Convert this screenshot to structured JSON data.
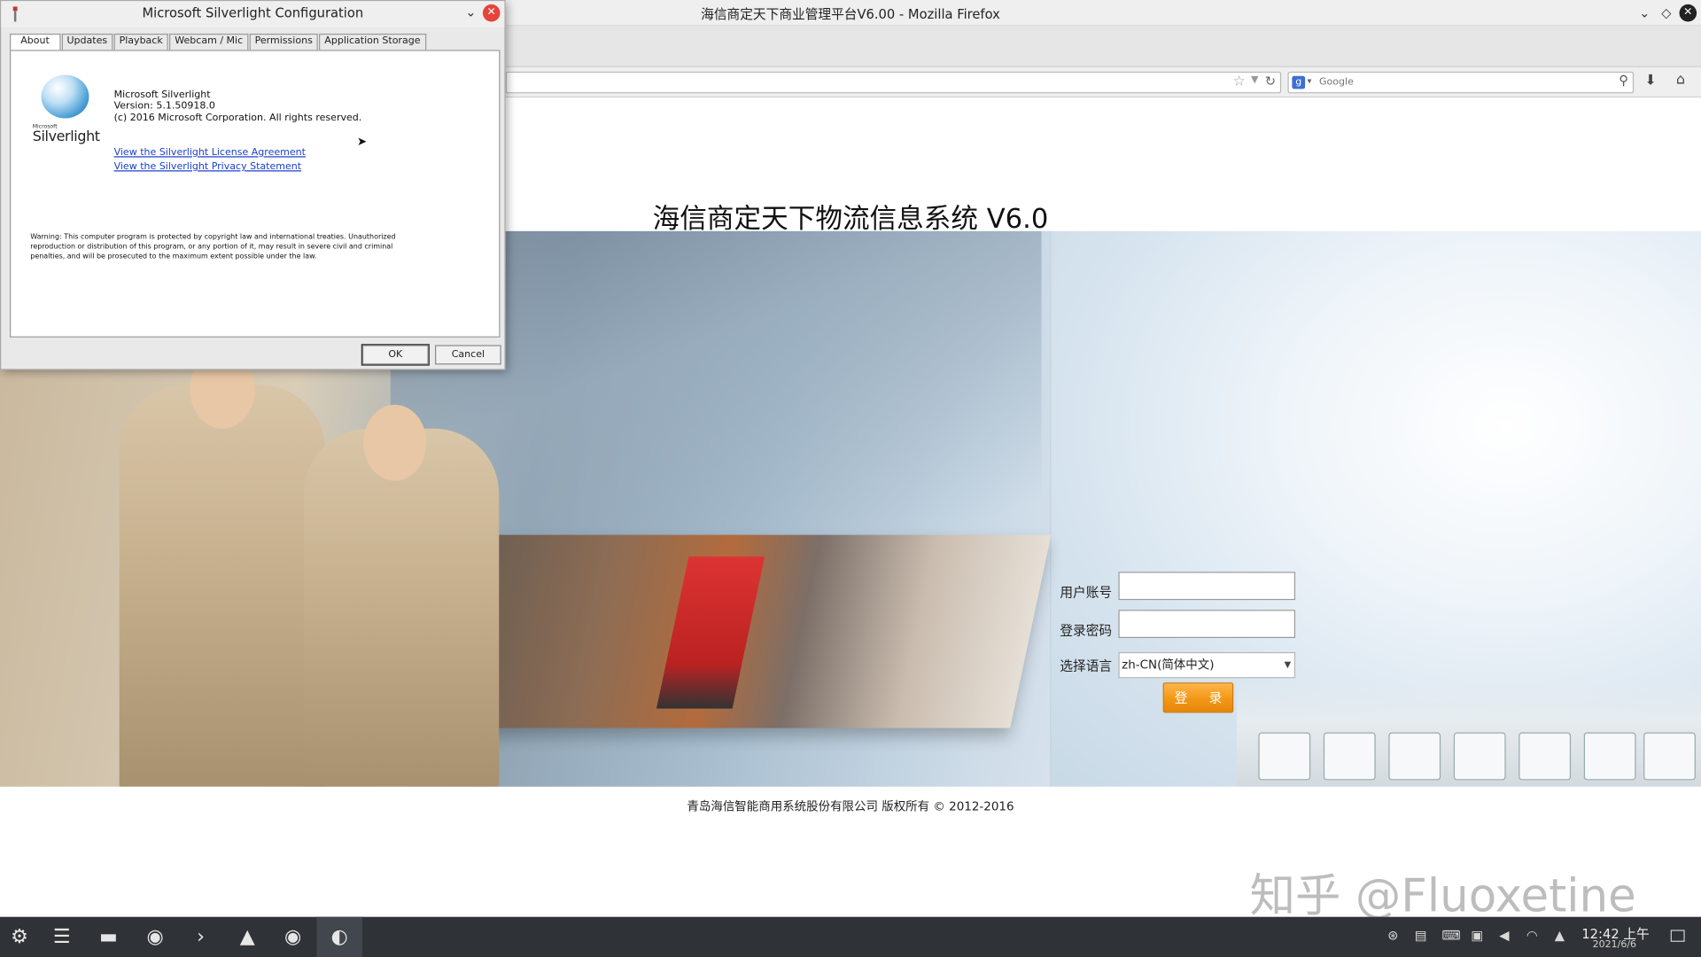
{
  "firefox": {
    "window_title": "海信商定天下商业管理平台V6.00 - Mozilla Firefox",
    "search_placeholder": "Google"
  },
  "page": {
    "title": "海信商定天下物流信息系统 V6.0",
    "login": {
      "username_label": "用户账号",
      "password_label": "登录密码",
      "language_label": "选择语言",
      "language_value": "zh-CN(简体中文)",
      "login_button": "登 录"
    },
    "copyright": "青岛海信智能商用系统股份有限公司 版权所有 © 2012-2016",
    "watermark": "知乎 @Fluoxetine"
  },
  "silverlight": {
    "title": "Microsoft Silverlight Configuration",
    "tabs": [
      "About",
      "Updates",
      "Playback",
      "Webcam / Mic",
      "Permissions",
      "Application Storage"
    ],
    "active_tab": "About",
    "logo_small": "Microsoft",
    "logo_text": "Silverlight",
    "product": "Microsoft Silverlight",
    "version": "Version: 5.1.50918.0",
    "copyright": "(c) 2016 Microsoft Corporation. All rights reserved.",
    "link_license": "View the Silverlight License Agreement",
    "link_privacy": "View the Silverlight Privacy Statement",
    "warning": "Warning: This computer program is protected by copyright law and international treaties. Unauthorized reproduction or distribution of this program, or any portion of it, may result in severe civil and criminal penalties, and will be prosecuted to the maximum extent possible under the law.",
    "ok_label": "OK",
    "cancel_label": "Cancel"
  },
  "taskbar": {
    "time": "12:42 上午",
    "date": "2021/6/6"
  },
  "colors": {
    "login_button": "#f39a1a",
    "link": "#1a3fcf",
    "taskbar": "#2f3337",
    "close_button": "#e5443b"
  }
}
